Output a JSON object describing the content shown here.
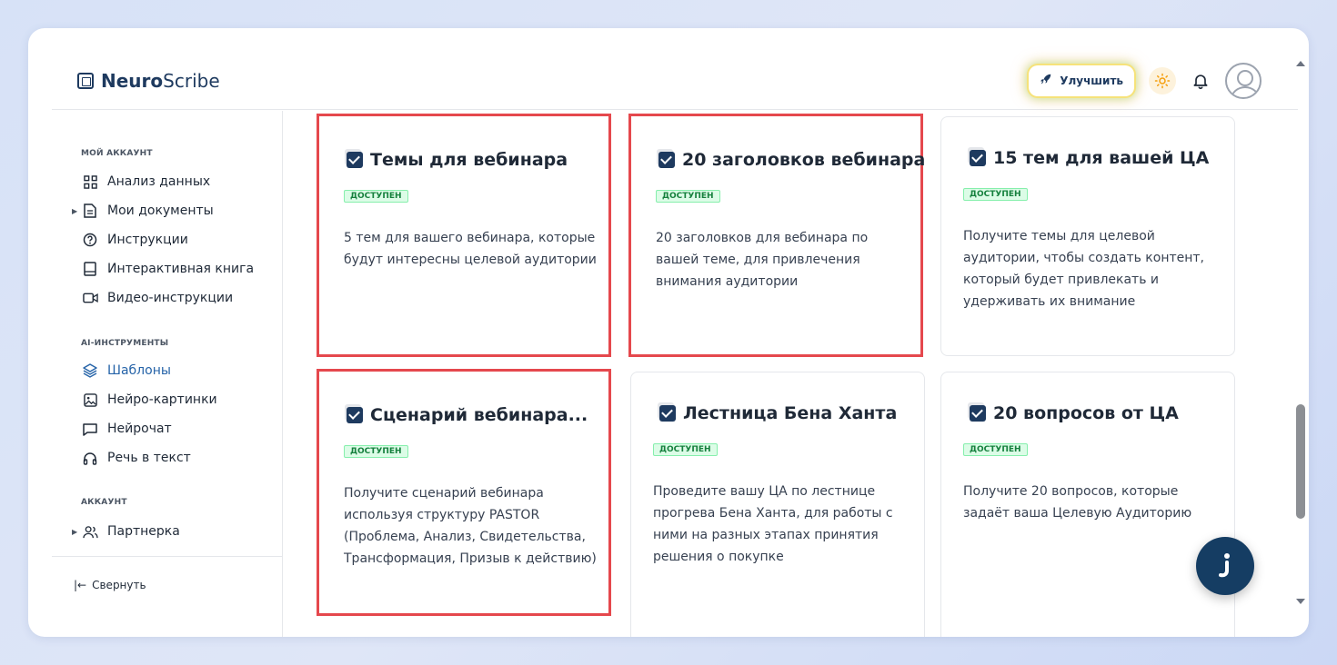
{
  "brand": {
    "bold": "Neuro",
    "light": "Scribe"
  },
  "header": {
    "upgrade_label": "Улучшить"
  },
  "sidebar": {
    "sections": [
      {
        "title": "МОЙ АККАУНТ",
        "items": [
          {
            "label": "Анализ данных",
            "icon": "grid-icon"
          },
          {
            "label": "Мои документы",
            "icon": "document-icon",
            "expandable": true
          },
          {
            "label": "Инструкции",
            "icon": "help-circle-icon"
          },
          {
            "label": "Интерактивная книга",
            "icon": "book-icon"
          },
          {
            "label": "Видео-инструкции",
            "icon": "video-icon"
          }
        ]
      },
      {
        "title": "AI-ИНСТРУМЕНТЫ",
        "items": [
          {
            "label": "Шаблоны",
            "icon": "layers-icon",
            "active": true
          },
          {
            "label": "Нейро-картинки",
            "icon": "image-icon"
          },
          {
            "label": "Нейрочат",
            "icon": "chat-icon"
          },
          {
            "label": "Речь в текст",
            "icon": "headphones-icon"
          }
        ]
      },
      {
        "title": "АККАУНТ",
        "items": [
          {
            "label": "Партнерка",
            "icon": "users-icon",
            "expandable": true
          }
        ]
      }
    ],
    "collapse_label": "Свернуть"
  },
  "cards": [
    {
      "title": "Темы для вебинара",
      "badge": "ДОСТУПЕН",
      "desc": "5 тем для вашего вебинара, которые будут интересны целевой аудитории",
      "highlighted": true
    },
    {
      "title": "20 заголовков вебинара",
      "badge": "ДОСТУПЕН",
      "desc": "20 заголовков для вебинара по вашей теме, для привлечения внимания аудитории",
      "highlighted": true
    },
    {
      "title": "15 тем для вашей ЦА",
      "badge": "ДОСТУПЕН",
      "desc": "Получите темы для целевой аудитории, чтобы создать контент, который будет привлекать и удерживать их внимание",
      "highlighted": false
    },
    {
      "title": "Сценарий вебинара...",
      "badge": "ДОСТУПЕН",
      "desc": "Получите сценарий вебинара используя структуру PASTOR (Проблема, Анализ, Свидетельства, Трансформация, Призыв к действию)",
      "highlighted": true
    },
    {
      "title": "Лестница Бена Ханта",
      "badge": "ДОСТУПЕН",
      "desc": "Проведите вашу ЦА по лестнице прогрева Бена Ханта, для работы с ними на разных этапах принятия решения о покупке",
      "highlighted": false
    },
    {
      "title": "20 вопросов от ЦА",
      "badge": "ДОСТУПЕН",
      "desc": "Получите 20 вопросов, которые задаёт ваша Целевую Аудиторию",
      "highlighted": false
    }
  ],
  "colors": {
    "accent": "#1e3a5f",
    "highlight": "#e5484d",
    "badge_bg": "#dcfce7",
    "badge_text": "#15803d"
  }
}
